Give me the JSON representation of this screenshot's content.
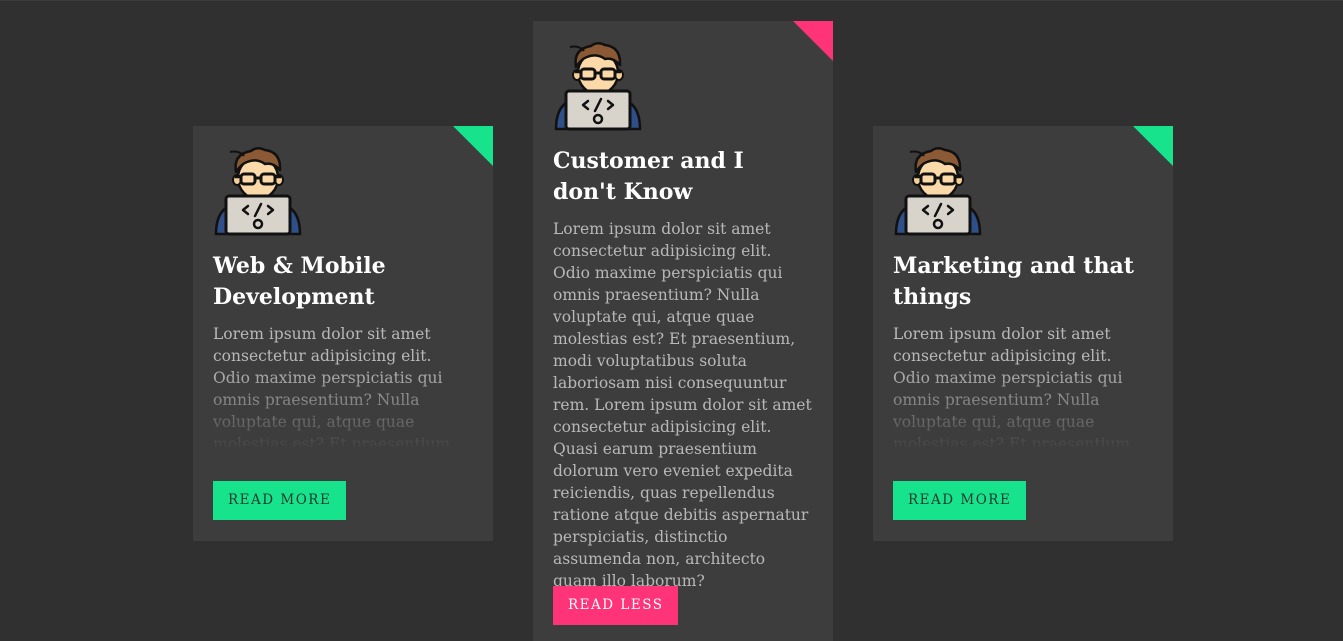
{
  "colors": {
    "background": "#303030",
    "card": "#3d3d3d",
    "accent_green": "#17e38c",
    "accent_pink": "#ff3377"
  },
  "cards": [
    {
      "icon": "developer-avatar-icon",
      "title": "Web & Mobile Development",
      "description": "Lorem ipsum dolor sit amet consectetur adipisicing elit. Odio maxime perspiciatis qui omnis praesentium? Nulla voluptate qui, atque quae molestias est? Et praesentium, modi voluptatibus soluta laboriosam nisi consequuntur rem.",
      "button_label": "READ MORE",
      "expanded": false
    },
    {
      "icon": "developer-avatar-icon",
      "title": "Customer and I don't Know",
      "description": "Lorem ipsum dolor sit amet consectetur adipisicing elit. Odio maxime perspiciatis qui omnis praesentium? Nulla voluptate qui, atque quae molestias est? Et praesentium, modi voluptatibus soluta laboriosam nisi consequuntur rem. Lorem ipsum dolor sit amet consectetur adipisicing elit. Quasi earum praesentium dolorum vero eveniet expedita reiciendis, quas repellendus ratione atque debitis aspernatur perspiciatis, distinctio assumenda non, architecto quam illo laborum?",
      "button_label": "READ LESS",
      "expanded": true
    },
    {
      "icon": "developer-avatar-icon",
      "title": "Marketing and that things",
      "description": "Lorem ipsum dolor sit amet consectetur adipisicing elit. Odio maxime perspiciatis qui omnis praesentium? Nulla voluptate qui, atque quae molestias est? Et praesentium, modi voluptatibus soluta laboriosam nisi consequuntur rem.",
      "button_label": "READ MORE",
      "expanded": false
    }
  ]
}
